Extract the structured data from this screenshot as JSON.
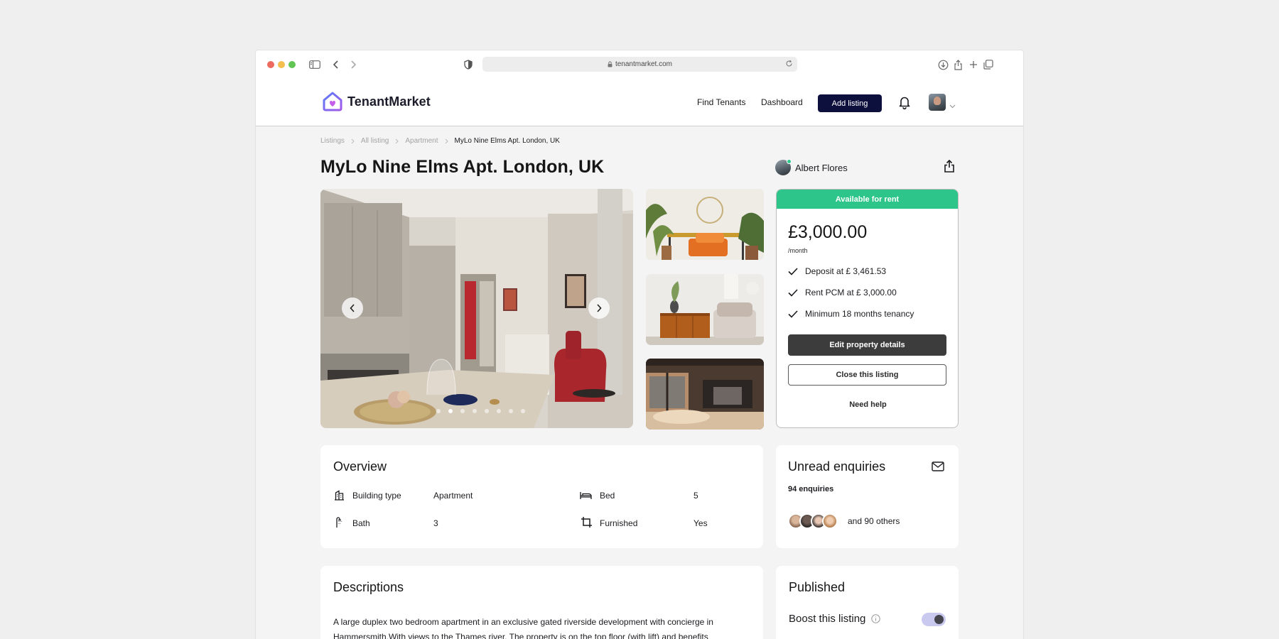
{
  "browser": {
    "url": "tenantmarket.com"
  },
  "header": {
    "brand": "TenantMarket",
    "nav": [
      "Find Tenants",
      "Dashboard"
    ],
    "add_listing": "Add listing"
  },
  "breadcrumb": [
    "Listings",
    "All listing",
    "Apartment",
    "MyLo Nine Elms Apt. London, UK"
  ],
  "listing": {
    "title": "MyLo Nine Elms Apt. London, UK",
    "owner": "Albert Flores",
    "gallery": {
      "slide_count": 8,
      "active_slide": 2
    }
  },
  "rent": {
    "status": "Available for rent",
    "price": "£3,000.00",
    "period": "/month",
    "facts": [
      "Deposit at  £ 3,461.53",
      "Rent PCM at £ 3,000.00",
      "Minimum 18 months tenancy"
    ],
    "edit_button": "Edit property details",
    "close_button": "Close this listing",
    "help": "Need help",
    "status_color": "#2ec58a"
  },
  "overview": {
    "title": "Overview",
    "rows": [
      {
        "label": "Building type",
        "value": "Apartment",
        "icon": "building-icon"
      },
      {
        "label": "Bed",
        "value": "5",
        "icon": "bed-icon"
      },
      {
        "label": "Bath",
        "value": "3",
        "icon": "bath-icon"
      },
      {
        "label": "Furnished",
        "value": "Yes",
        "icon": "crop-icon"
      }
    ]
  },
  "enquiries": {
    "title": "Unread enquiries",
    "count": "94 enquiries",
    "others": "and 90 others"
  },
  "descriptions": {
    "title": "Descriptions",
    "text": "A large duplex two bedroom apartment in an exclusive gated riverside development with concierge in Hammersmith.With views to the Thames river. The property is on the top floor (with lift) and benefits"
  },
  "published": {
    "title": "Published",
    "boost_label": "Boost this listing",
    "boost_on": true
  }
}
